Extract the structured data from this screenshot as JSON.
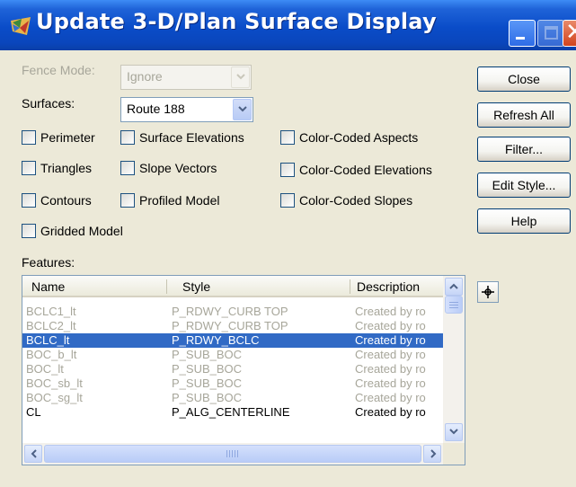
{
  "window": {
    "title": "Update 3-D/Plan Surface Display"
  },
  "fence_mode": {
    "label": "Fence Mode:",
    "value": "Ignore"
  },
  "surfaces": {
    "label": "Surfaces:",
    "value": "Route 188"
  },
  "checkboxes": {
    "perimeter": "Perimeter",
    "surface_elevations": "Surface Elevations",
    "color_coded_aspects": "Color-Coded Aspects",
    "triangles": "Triangles",
    "slope_vectors": "Slope Vectors",
    "color_coded_elevations": "Color-Coded Elevations",
    "contours": "Contours",
    "profiled_model": "Profiled Model",
    "color_coded_slopes": "Color-Coded Slopes",
    "gridded_model": "Gridded Model"
  },
  "buttons": {
    "close": "Close",
    "refresh_all": "Refresh All",
    "filter": "Filter...",
    "edit_style": "Edit Style...",
    "help": "Help"
  },
  "features": {
    "label": "Features:",
    "columns": [
      "Name",
      "Style",
      "Description"
    ],
    "rows": [
      [
        "BCLC1_lt",
        "P_RDWY_CURB TOP",
        "Created by ro"
      ],
      [
        "BCLC2_lt",
        "P_RDWY_CURB TOP",
        "Created by ro"
      ],
      [
        "BCLC_lt",
        "P_RDWY_BCLC",
        "Created by ro"
      ],
      [
        "BOC_b_lt",
        "P_SUB_BOC",
        "Created by ro"
      ],
      [
        "BOC_lt",
        "P_SUB_BOC",
        "Created by ro"
      ],
      [
        "BOC_sb_lt",
        "P_SUB_BOC",
        "Created by ro"
      ],
      [
        "BOC_sg_lt",
        "P_SUB_BOC",
        "Created by ro"
      ],
      [
        "CL",
        "P_ALG_CENTERLINE",
        "Created by ro"
      ]
    ]
  },
  "icons": {
    "app": "surface-app-icon",
    "locate": "crosshair-locate-icon"
  },
  "colors": {
    "titlebar": "#0A4CC8",
    "selection": "#316AC5",
    "dialog_bg": "#ECE9D8"
  }
}
